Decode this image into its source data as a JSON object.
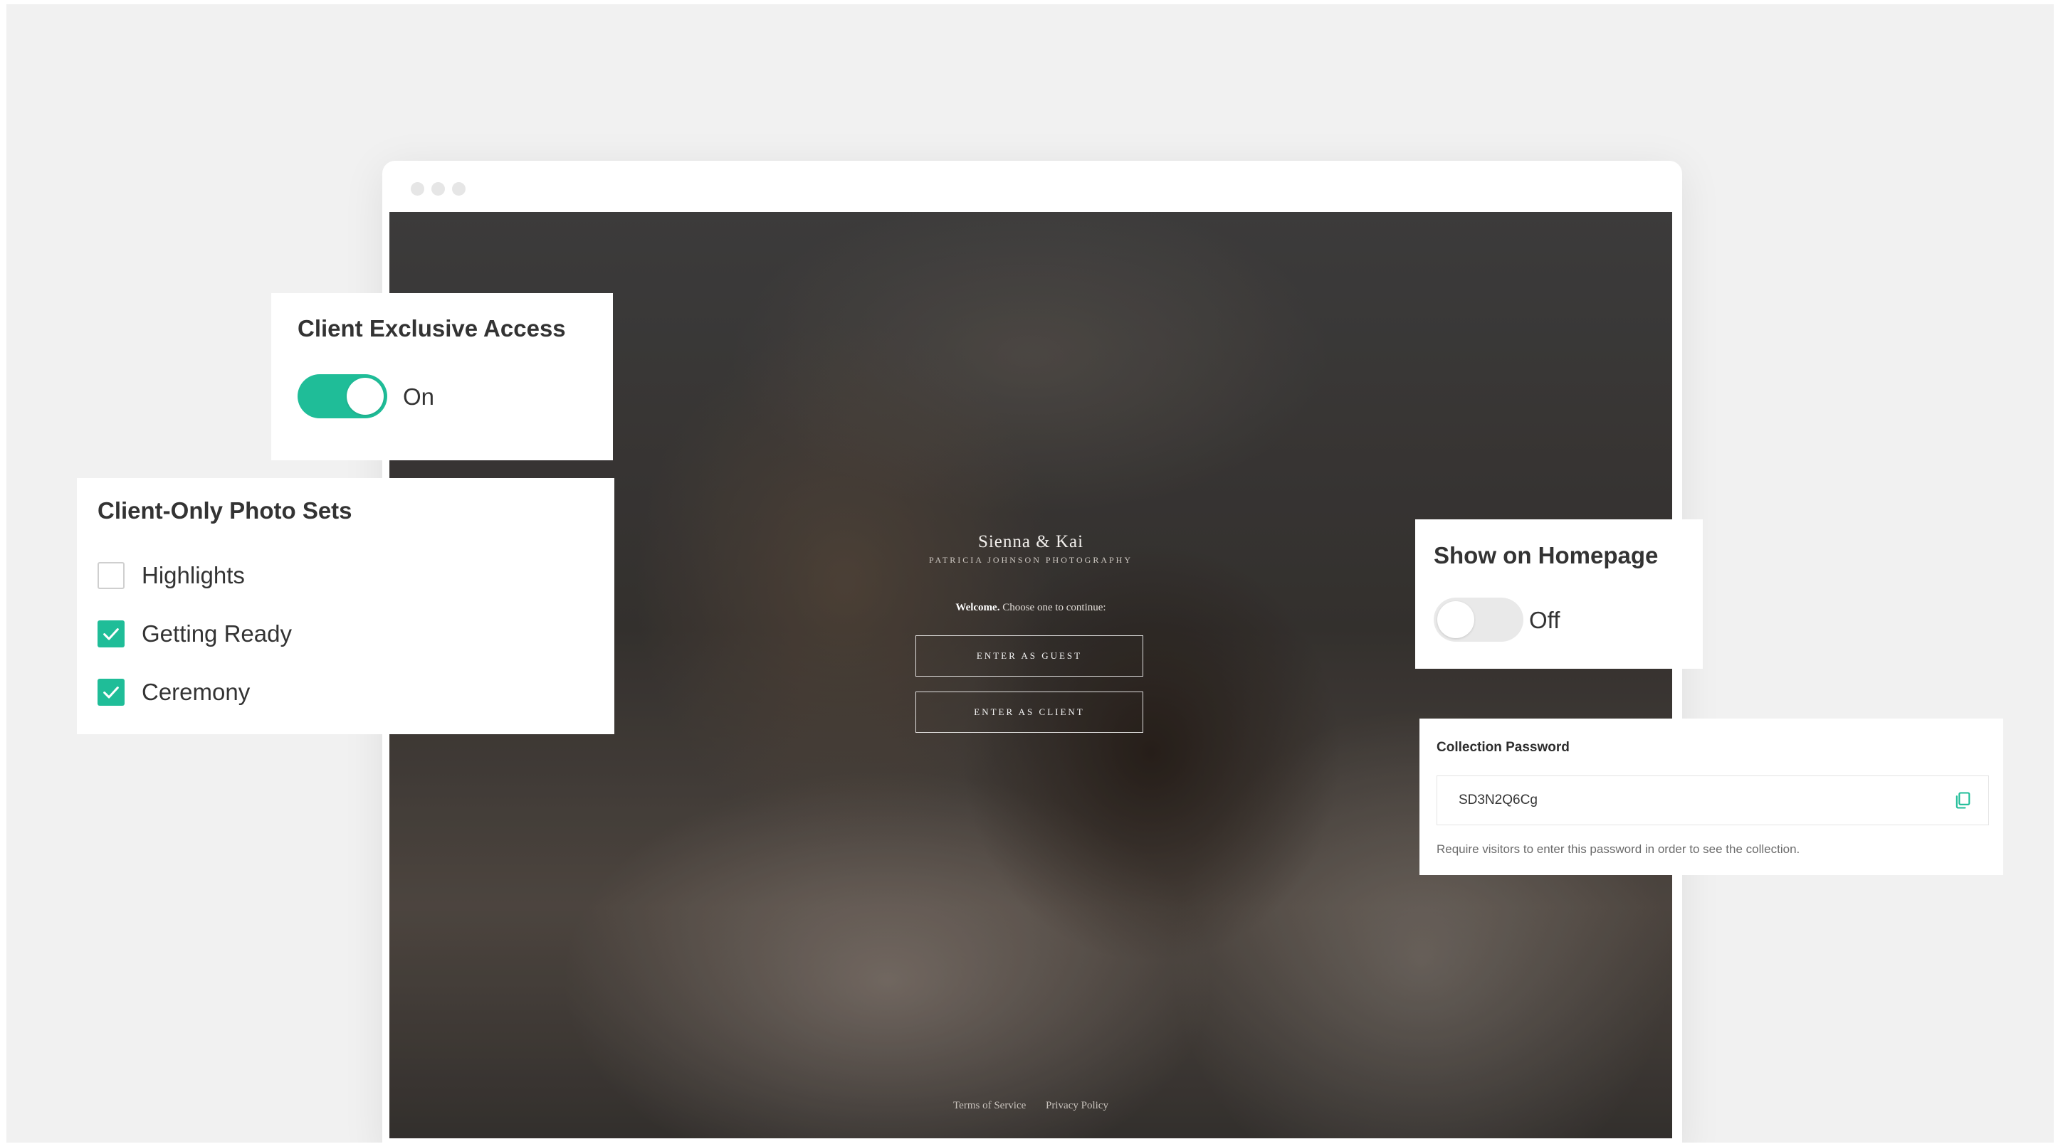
{
  "gallery": {
    "title": "Sienna & Kai",
    "subtitle": "PATRICIA JOHNSON PHOTOGRAPHY",
    "welcome_bold": "Welcome.",
    "welcome_rest": " Choose one to continue:",
    "enter_guest": "ENTER AS GUEST",
    "enter_client": "ENTER AS CLIENT",
    "footer": {
      "terms": "Terms of Service",
      "privacy": "Privacy Policy"
    }
  },
  "client_access": {
    "title": "Client Exclusive Access",
    "state": "On",
    "enabled": true
  },
  "photo_sets": {
    "title": "Client-Only Photo Sets",
    "items": [
      {
        "label": "Highlights",
        "checked": false
      },
      {
        "label": "Getting Ready",
        "checked": true
      },
      {
        "label": "Ceremony",
        "checked": true
      }
    ]
  },
  "homepage": {
    "title": "Show on Homepage",
    "state": "Off",
    "enabled": false
  },
  "password": {
    "label": "Collection Password",
    "value": "SD3N2Q6Cg",
    "help": "Require visitors to enter this password in order to see the collection."
  },
  "colors": {
    "accent": "#1fbd98",
    "text": "#333333",
    "toggle_off": "#e9e9e9"
  },
  "icons": {
    "copy": "copy-icon",
    "check": "check-icon"
  }
}
